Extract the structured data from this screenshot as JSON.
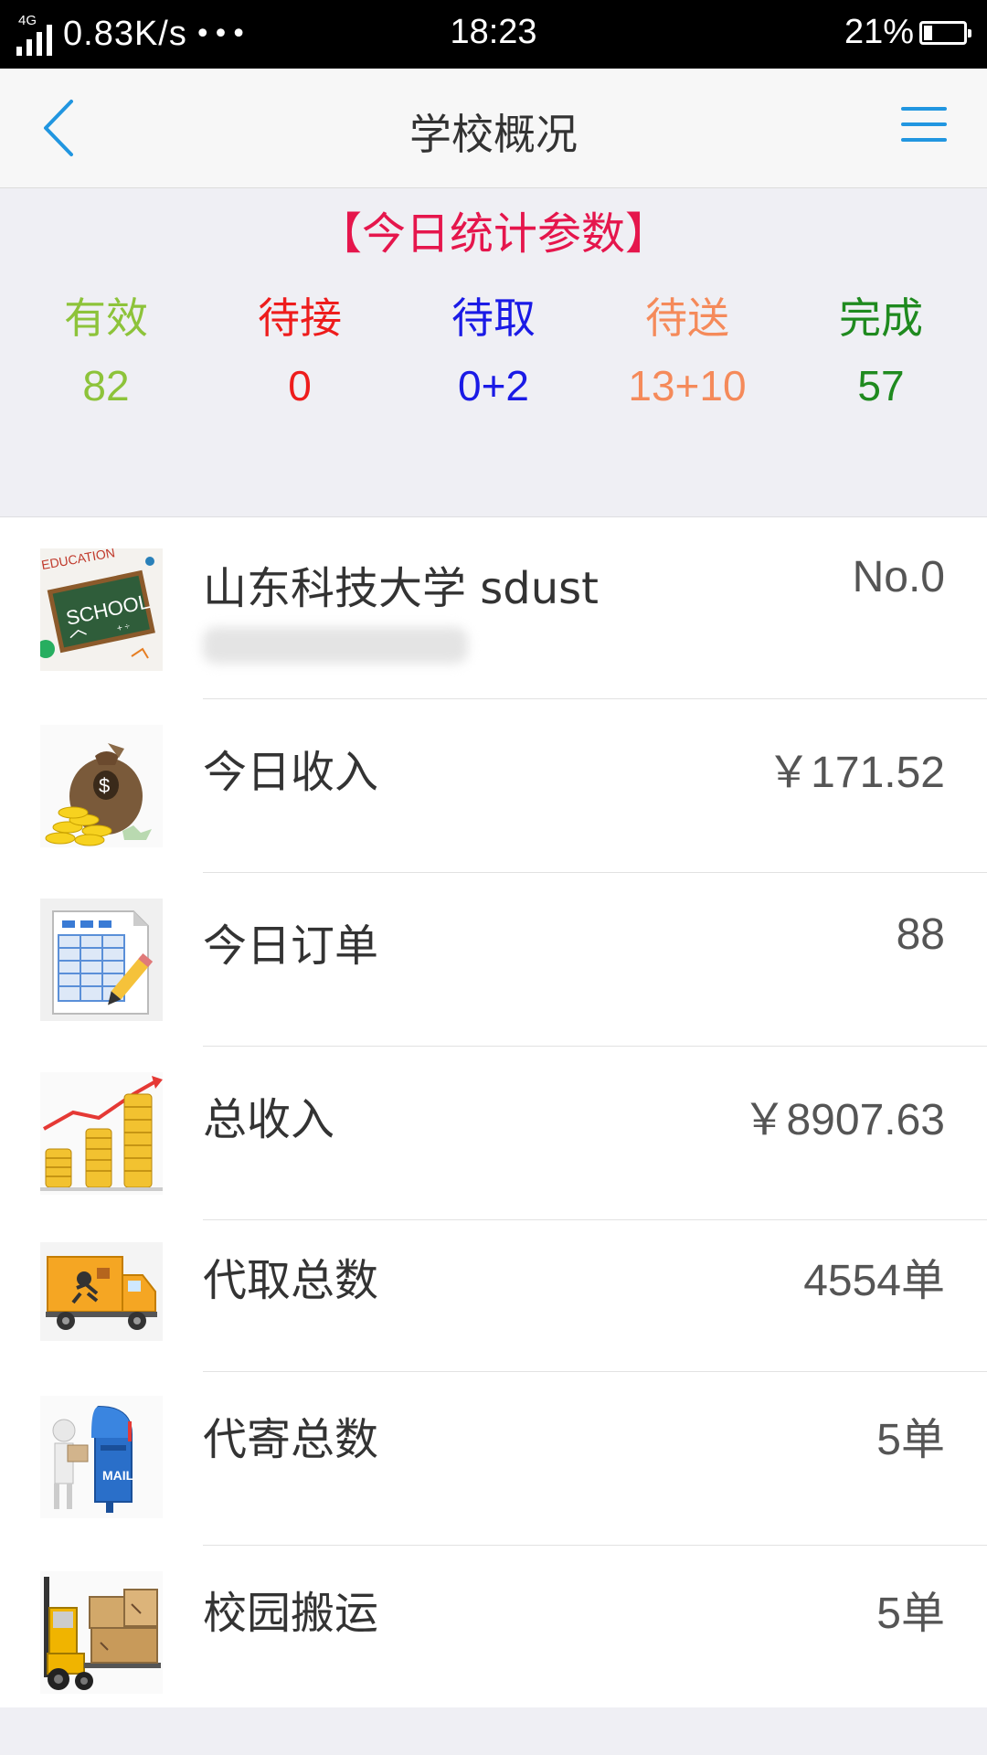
{
  "status_bar": {
    "network_type": "4G",
    "speed": "0.83K/s",
    "more": "•••",
    "time": "18:23",
    "battery": "21%",
    "battery_level": 0.21
  },
  "nav": {
    "title": "学校概况",
    "back_icon": "chevron-left-icon",
    "menu_icon": "hamburger-menu-icon",
    "accent_color": "#2196e0"
  },
  "stats": {
    "title": "【今日统计参数】",
    "title_color": "#e5164c",
    "items": [
      {
        "label": "有效",
        "value": "82",
        "color": "#8dc33a"
      },
      {
        "label": "待接",
        "value": "0",
        "color": "#ee1c1c"
      },
      {
        "label": "待取",
        "value": "0+2",
        "color": "#1a1ae6"
      },
      {
        "label": "待送",
        "value": "13+10",
        "color": "#f58a5a"
      },
      {
        "label": "完成",
        "value": "57",
        "color": "#1f8a1f"
      }
    ]
  },
  "list": {
    "school": {
      "name": "山东科技大学 sdust",
      "rank": "No.0",
      "icon": "school-chalkboard-icon"
    },
    "rows": [
      {
        "label": "今日收入",
        "value": "￥171.52",
        "icon": "money-bag-icon"
      },
      {
        "label": "今日订单",
        "value": "88",
        "icon": "spreadsheet-pencil-icon"
      },
      {
        "label": "总收入",
        "value": "￥8907.63",
        "icon": "coin-stacks-icon"
      },
      {
        "label": "代取总数",
        "value": "4554单",
        "icon": "delivery-truck-icon"
      },
      {
        "label": "代寄总数",
        "value": "5单",
        "icon": "mailbox-icon"
      },
      {
        "label": "校园搬运",
        "value": "5单",
        "icon": "forklift-icon"
      }
    ]
  }
}
